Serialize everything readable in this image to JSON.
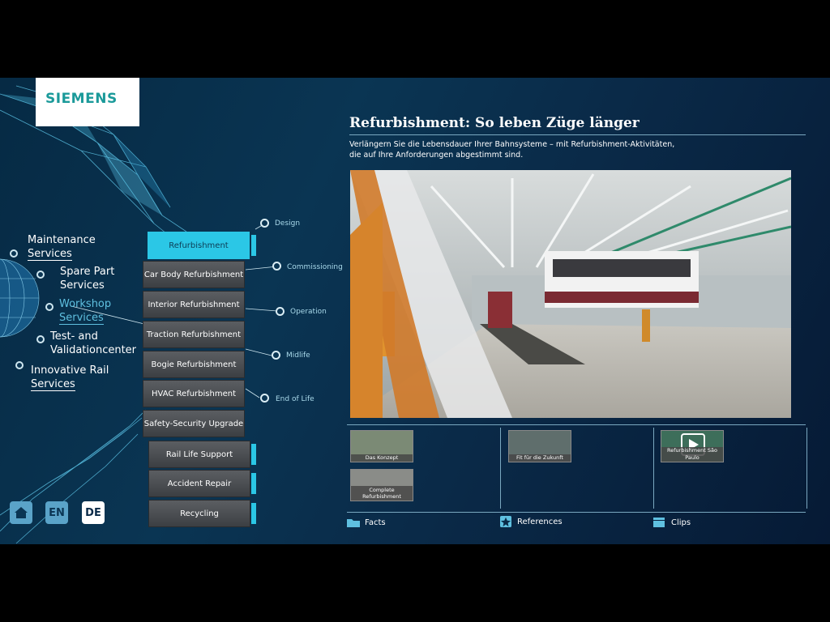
{
  "brand": {
    "logo_text": "SIEMENS"
  },
  "services": [
    {
      "line1": "Maintenance",
      "line2": "Services"
    },
    {
      "line1": "Spare Part",
      "line2": "Services"
    },
    {
      "line1": "Workshop",
      "line2": "Services"
    },
    {
      "line1": "Test- and",
      "line2": "Validationcenter"
    },
    {
      "line1": "Innovative Rail",
      "line2": "Services"
    }
  ],
  "menu": [
    "Refurbishment",
    "Car Body Refurbishment",
    "Interior Refurbishment",
    "Traction Refurbishment",
    "Bogie Refurbishment",
    "HVAC Refurbishment",
    "Safety-Security Upgrade",
    "Rail Life Support",
    "Accident Repair",
    "Recycling"
  ],
  "phases": [
    "Design",
    "Commissioning",
    "Operation",
    "Midlife",
    "End of Life"
  ],
  "content": {
    "title": "Refurbishment: So leben Züge länger",
    "subtitle_line1": "Verlängern Sie die Lebensdauer Ihrer Bahnsysteme – mit Refurbishment-Aktivitäten,",
    "subtitle_line2": "die auf Ihre Anforderungen abgestimmt sind."
  },
  "thumbs": [
    {
      "caption": "Das Konzept"
    },
    {
      "caption": "Complete Refurbishment"
    },
    {
      "caption": "Fit für die Zukunft"
    },
    {
      "caption": "Refurbishment São Paulo"
    }
  ],
  "footer_tabs": [
    "Facts",
    "References",
    "Clips"
  ],
  "nav": {
    "home": "home",
    "en": "EN",
    "de": "DE"
  },
  "colors": {
    "accent": "#2bc7e6",
    "brand": "#1b9a9a",
    "active_text": "#5fc0e0"
  }
}
